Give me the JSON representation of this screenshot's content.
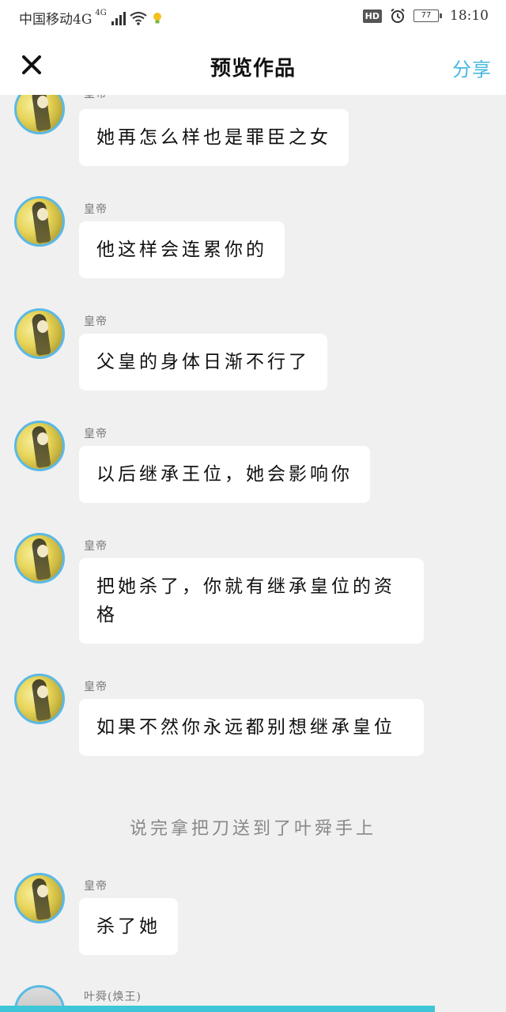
{
  "status_bar": {
    "carrier": "中国移动4G",
    "network": "4G",
    "hd": "HD",
    "battery": "77",
    "time": "18:10"
  },
  "header": {
    "title": "预览作品",
    "share_label": "分享"
  },
  "messages": [
    {
      "sender": "皇帝",
      "text": "她再怎么样也是罪臣之女"
    },
    {
      "sender": "皇帝",
      "text": "他这样会连累你的"
    },
    {
      "sender": "皇帝",
      "text": "父皇的身体日渐不行了"
    },
    {
      "sender": "皇帝",
      "text": "以后继承王位，她会影响你"
    },
    {
      "sender": "皇帝",
      "text": "把她杀了，你就有继承皇位的资格"
    },
    {
      "sender": "皇帝",
      "text": "如果不然你永远都别想继承皇位"
    }
  ],
  "narration": "说完拿把刀送到了叶舜手上",
  "messages_after": [
    {
      "sender": "皇帝",
      "text": "杀了她"
    },
    {
      "sender": "叶舜(焕王)",
      "text": ""
    }
  ]
}
